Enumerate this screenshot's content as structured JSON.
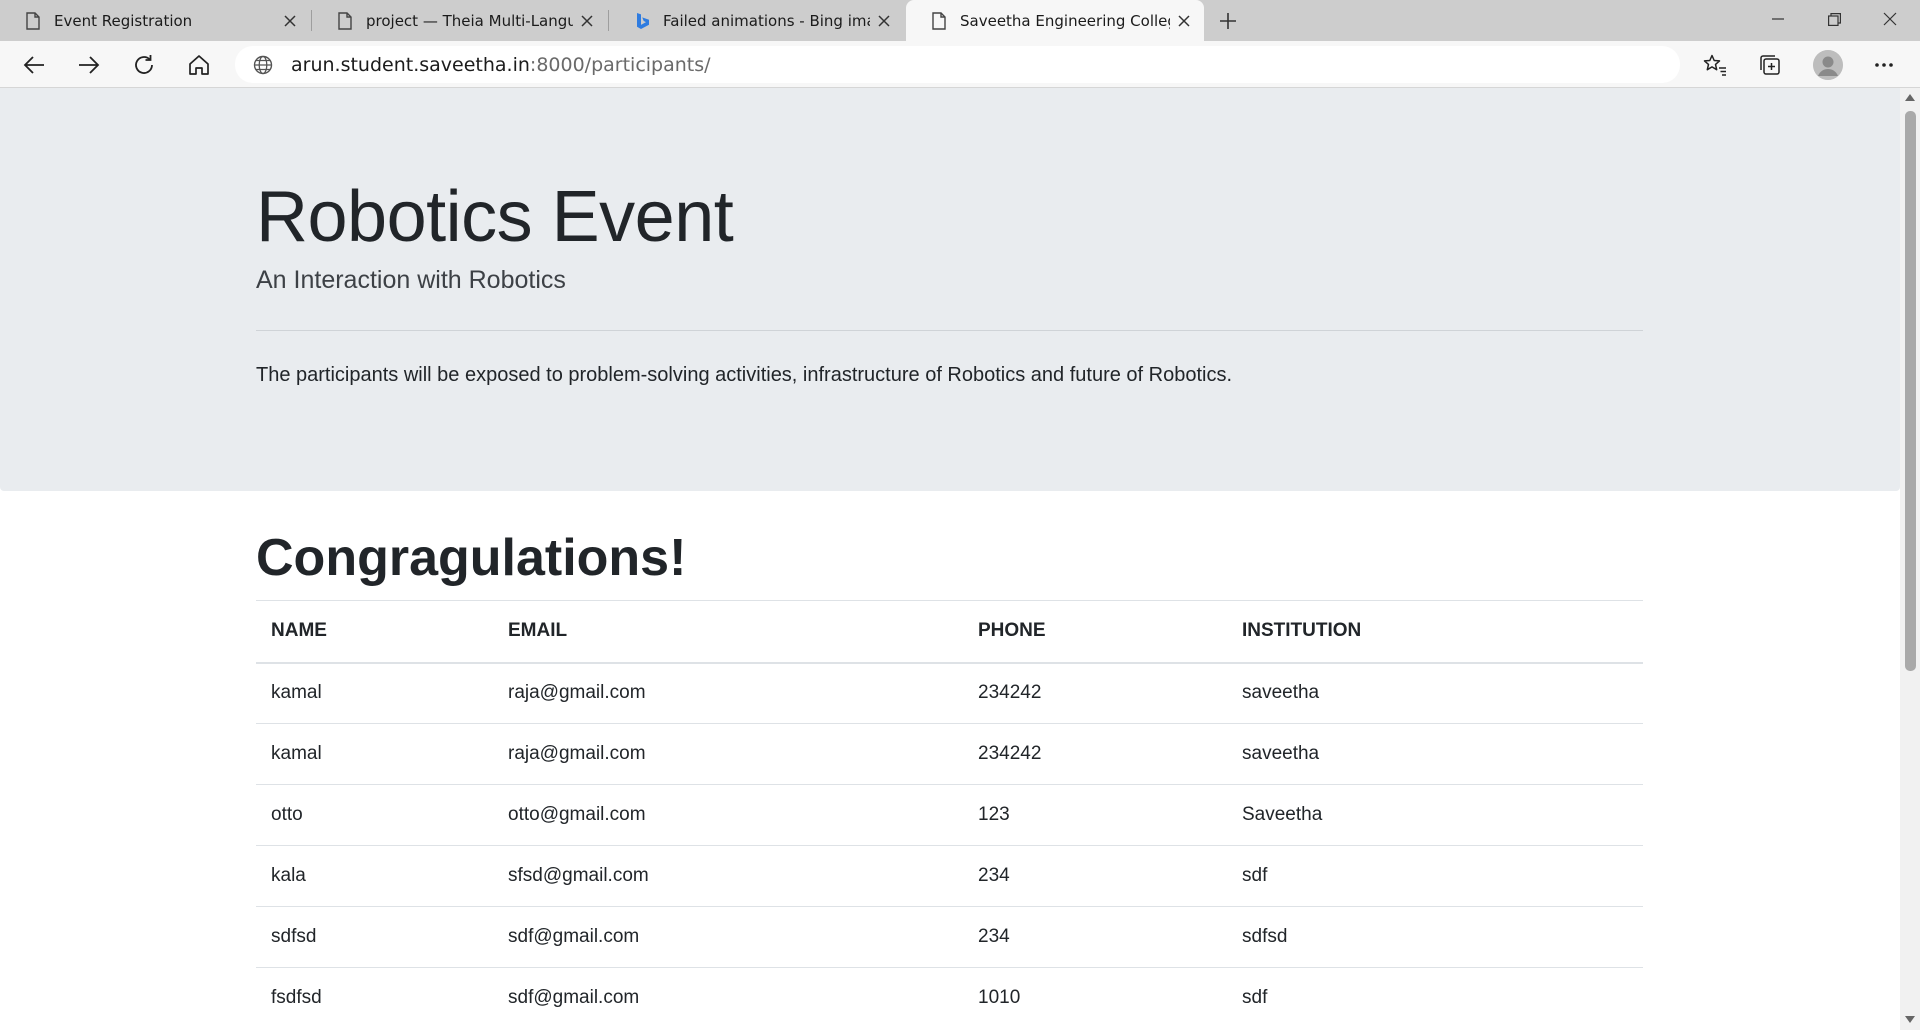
{
  "browser": {
    "tabs": [
      {
        "title": "Event Registration",
        "active": false
      },
      {
        "title": "project — Theia Multi-Language",
        "active": false
      },
      {
        "title": "Failed animations - Bing images",
        "active": false
      },
      {
        "title": "Saveetha Engineering College",
        "active": true
      }
    ],
    "url_host": "arun.student.saveetha.in",
    "url_path": ":8000/participants/"
  },
  "jumbotron": {
    "title": "Robotics Event",
    "subtitle": "An Interaction with Robotics",
    "lead": "The participants will be exposed to problem-solving activities, infrastructure of Robotics and future of Robotics."
  },
  "content": {
    "heading": "Congragulations!",
    "table": {
      "columns": [
        "NAME",
        "EMAIL",
        "PHONE",
        "INSTITUTION"
      ],
      "rows": [
        [
          "kamal",
          "raja@gmail.com",
          "234242",
          "saveetha"
        ],
        [
          "kamal",
          "raja@gmail.com",
          "234242",
          "saveetha"
        ],
        [
          "otto",
          "otto@gmail.com",
          "123",
          "Saveetha"
        ],
        [
          "kala",
          "sfsd@gmail.com",
          "234",
          "sdf"
        ],
        [
          "sdfsd",
          "sdf@gmail.com",
          "234",
          "sdfsd"
        ],
        [
          "fsdfsd",
          "sdf@gmail.com",
          "1010",
          "sdf"
        ]
      ]
    }
  },
  "colors": {
    "jumbotron_bg": "#e9ecef",
    "tabstrip_bg": "#cdcdcd",
    "toolbar_bg": "#f7f7f7",
    "bing_blue": "#2f7ce0"
  },
  "icons": {
    "tab_page": "page-icon",
    "tab_bing": "bing-icon",
    "close": "close-icon",
    "new_tab": "plus-icon",
    "back": "back-arrow-icon",
    "forward": "forward-arrow-icon",
    "refresh": "refresh-icon",
    "home": "home-icon",
    "site_info": "globe-icon",
    "favorites": "favorites-icon",
    "collections": "collections-icon",
    "profile": "profile-icon",
    "more": "more-icon"
  }
}
